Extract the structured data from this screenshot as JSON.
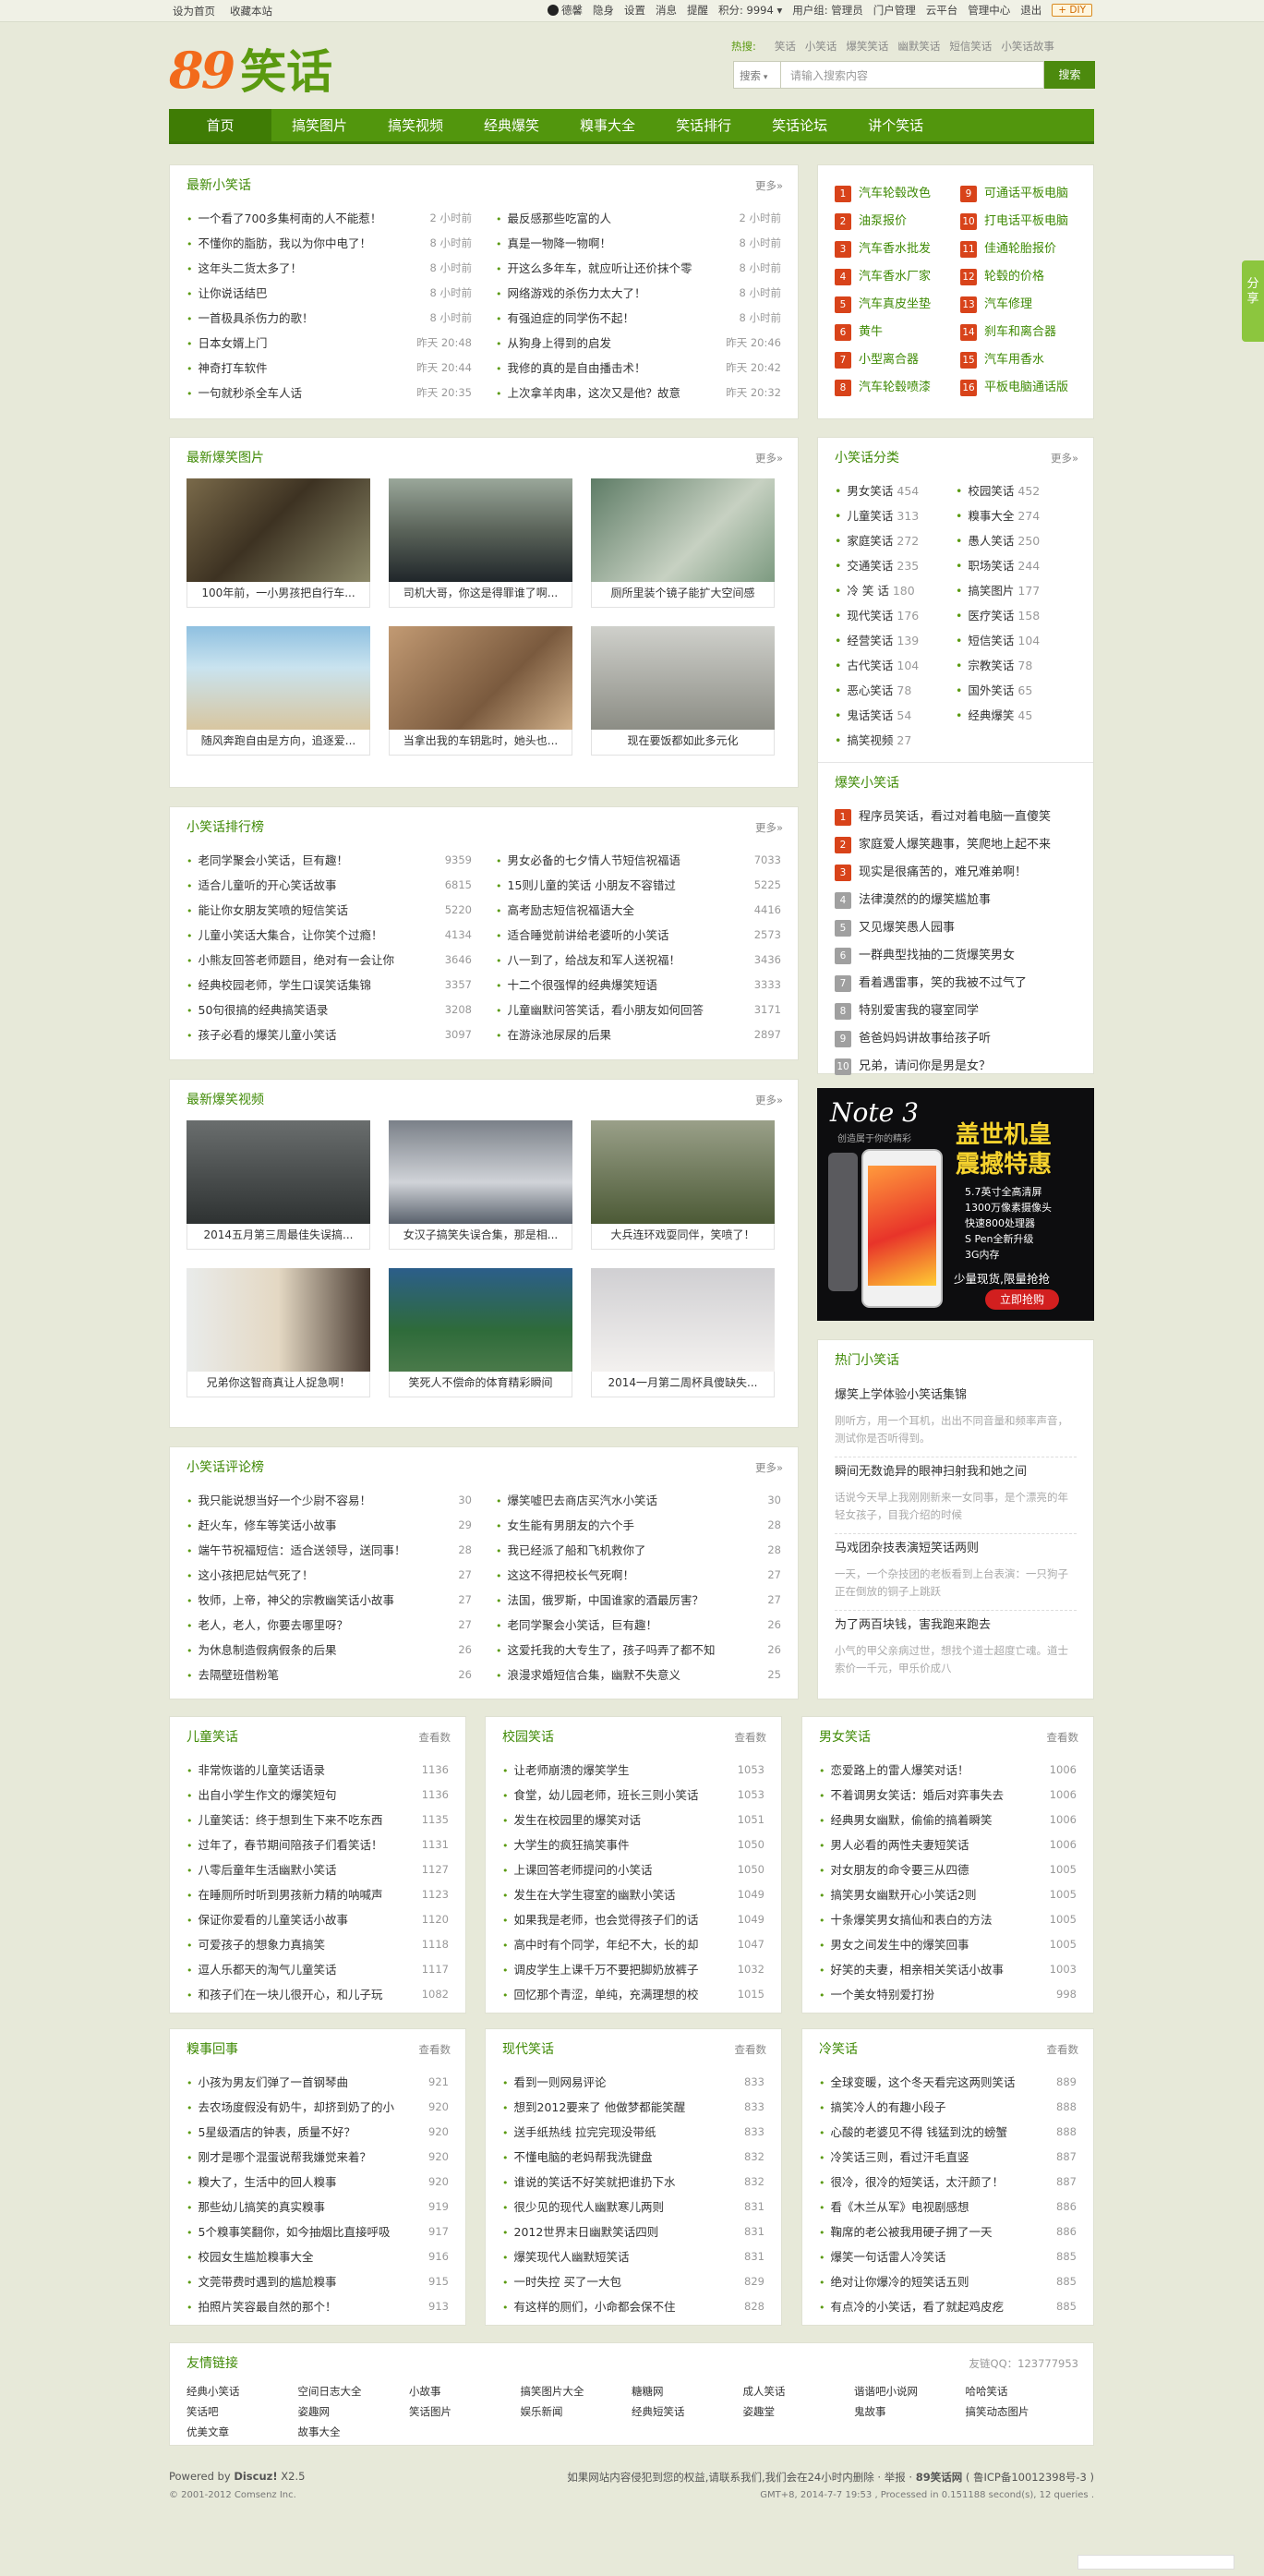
{
  "topbar": {
    "left": [
      "设为首页",
      "收藏本站"
    ],
    "user": "德馨",
    "links": [
      "隐身",
      "设置",
      "消息",
      "提醒"
    ],
    "points": "积分: 9994 ▾",
    "group": "用户组: 管理员",
    "admin": [
      "门户管理",
      "云平台",
      "管理中心",
      "退出"
    ],
    "diy": "+ DIY"
  },
  "logo": {
    "num": "89",
    "text": "笑话"
  },
  "hot": {
    "label": "热搜:",
    "items": [
      "笑话",
      "小笑话",
      "爆笑笑话",
      "幽默笑话",
      "短信笑话",
      "小笑话故事"
    ]
  },
  "search": {
    "type": "搜索",
    "placeholder": "请输入搜索内容",
    "button": "搜索"
  },
  "nav": [
    "首页",
    "搞笑图片",
    "搞笑视频",
    "经典爆笑",
    "糗事大全",
    "笑话排行",
    "笑话论坛",
    "讲个笑话"
  ],
  "latest": {
    "title": "最新小笑话",
    "more": "更多»",
    "left": [
      [
        "一个看了700多集柯南的人不能惹！",
        "2 小时前"
      ],
      [
        "不懂你的脂肪，我以为你中电了！",
        "8 小时前"
      ],
      [
        "这年头二货太多了！",
        "8 小时前"
      ],
      [
        "让你说话结巴",
        "8 小时前"
      ],
      [
        "一首极具杀伤力的歌！",
        "8 小时前"
      ],
      [
        "日本女婿上门",
        "昨天 20:48"
      ],
      [
        "神奇打车软件",
        "昨天 20:44"
      ],
      [
        "一句就秒杀全车人话",
        "昨天 20:35"
      ]
    ],
    "right": [
      [
        "最反感那些吃富的人",
        "2 小时前"
      ],
      [
        "真是一物降一物啊！",
        "8 小时前"
      ],
      [
        "开这么多年车，就应听让还价抹个零",
        "8 小时前"
      ],
      [
        "网络游戏的杀伤力太大了！",
        "8 小时前"
      ],
      [
        "有强迫症的同学伤不起！",
        "8 小时前"
      ],
      [
        "从狗身上得到的启发",
        "昨天 20:46"
      ],
      [
        "我修的真的是自由播击术！",
        "昨天 20:42"
      ],
      [
        "上次拿羊肉串，这次又是他？故意",
        "昨天 20:32"
      ]
    ]
  },
  "toplinks": {
    "left": [
      [
        "1",
        "汽车轮毂改色"
      ],
      [
        "2",
        "油泵报价"
      ],
      [
        "3",
        "汽车香水批发"
      ],
      [
        "4",
        "汽车香水厂家"
      ],
      [
        "5",
        "汽车真皮坐垫"
      ],
      [
        "6",
        "黄牛"
      ],
      [
        "7",
        "小型离合器"
      ],
      [
        "8",
        "汽车轮毂喷漆"
      ]
    ],
    "right": [
      [
        "9",
        "可通话平板电脑"
      ],
      [
        "10",
        "打电话平板电脑"
      ],
      [
        "11",
        "佳通轮胎报价"
      ],
      [
        "12",
        "轮毂的价格"
      ],
      [
        "13",
        "汽车修理"
      ],
      [
        "14",
        "刹车和离合器"
      ],
      [
        "15",
        "汽车用香水"
      ],
      [
        "16",
        "平板电脑通话版"
      ]
    ]
  },
  "pics": {
    "title": "最新爆笑图片",
    "more": "更多»",
    "items": [
      "100年前，一小男孩把自行车...",
      "司机大哥，你这是得罪谁了啊...",
      "厕所里装个镜子能扩大空间感",
      "随风奔跑自由是方向，追逐爱...",
      "当拿出我的车钥匙时，她头也...",
      "现在要饭都如此多元化"
    ]
  },
  "rank": {
    "title": "小笑话排行榜",
    "more": "更多»",
    "left": [
      [
        "老同学聚会小笑话，巨有趣！",
        "9359"
      ],
      [
        "适合儿童听的开心笑话故事",
        "6815"
      ],
      [
        "能让你女朋友笑喷的短信笑话",
        "5220"
      ],
      [
        "儿童小笑话大集合，让你笑个过瘾！",
        "4134"
      ],
      [
        "小熊友回答老师题目，绝对有一会让你",
        "3646"
      ],
      [
        "经典校园老师，学生口误笑话集锦",
        "3357"
      ],
      [
        "50句很搞的经典搞笑语录",
        "3208"
      ],
      [
        "孩子必看的爆笑儿童小笑话",
        "3097"
      ]
    ],
    "right": [
      [
        "男女必备的七夕情人节短信祝福语",
        "7033"
      ],
      [
        "15则儿童的笑话 小朋友不容错过",
        "5225"
      ],
      [
        "高考励志短信祝福语大全",
        "4416"
      ],
      [
        "适合睡觉前讲给老婆听的小笑话",
        "2573"
      ],
      [
        "八一到了，给战友和军人送祝福！",
        "3436"
      ],
      [
        "十二个很强悍的经典爆笑短语",
        "3333"
      ],
      [
        "儿童幽默问答笑话，看小朋友如何回答",
        "3171"
      ],
      [
        "在游泳池尿尿的后果",
        "2897"
      ]
    ]
  },
  "cats": {
    "title": "小笑话分类",
    "more": "更多»",
    "items": [
      [
        "男女笑话",
        "454"
      ],
      [
        "校园笑话",
        "452"
      ],
      [
        "儿童笑话",
        "313"
      ],
      [
        "糗事大全",
        "274"
      ],
      [
        "家庭笑话",
        "272"
      ],
      [
        "愚人笑话",
        "250"
      ],
      [
        "交通笑话",
        "235"
      ],
      [
        "职场笑话",
        "244"
      ],
      [
        "冷 笑 话",
        "180"
      ],
      [
        "搞笑图片",
        "177"
      ],
      [
        "现代笑话",
        "176"
      ],
      [
        "医疗笑话",
        "158"
      ],
      [
        "经营笑话",
        "139"
      ],
      [
        "短信笑话",
        "104"
      ],
      [
        "古代笑话",
        "104"
      ],
      [
        "宗教笑话",
        "78"
      ],
      [
        "恶心笑话",
        "78"
      ],
      [
        "国外笑话",
        "65"
      ],
      [
        "鬼话笑话",
        "54"
      ],
      [
        "经典爆笑",
        "45"
      ],
      [
        "搞笑视频",
        "27"
      ]
    ]
  },
  "hotrank": {
    "title": "爆笑小笑话",
    "items": [
      "程序员笑话，看过对着电脑一直傻笑",
      "家庭爱人爆笑趣事，笑爬地上起不来",
      "现实是很痛苦的，难兄难弟啊！",
      "法律漠然的的爆笑尴尬事",
      "又见爆笑愚人园事",
      "一群典型找抽的二货爆笑男女",
      "看着遇雷事，笑的我被不过气了",
      "特别爱害我的寝室同学",
      "爸爸妈妈讲故事给孩子听",
      "兄弟，请问你是男是女？"
    ]
  },
  "ad": {
    "brand": "Note 3",
    "slogan": "创造属于你的精彩",
    "title1": "盖世机皇",
    "title2": "震撼特惠",
    "specs": [
      "5.7英寸全高清屏",
      "1300万像素摄像头",
      "快速800处理器",
      "S Pen全新升级",
      "3G内存"
    ],
    "promo": "少量现货,限量抢抢",
    "btn": "立即抢购"
  },
  "videos": {
    "title": "最新爆笑视频",
    "more": "更多»",
    "items": [
      "2014五月第三周最佳失误搞...",
      "女汉子搞笑失误合集，那是相...",
      "大兵连环戏耍同伴，笑喷了！",
      "兄弟你这智商真让人捉急啊！",
      "笑死人不偿命的体育精彩瞬间",
      "2014一月第二周杯具傻缺失..."
    ]
  },
  "hotjokes": {
    "title": "热门小笑话",
    "items": [
      [
        "爆笑上学体验小笑话集锦",
        "刚听方，用一个耳机，出出不同音量和频率声音，测试你是否听得到。"
      ],
      [
        "瞬间无数诡异的眼神扫射我和她之间",
        "话说今天早上我刚刚新来一女同事，是个漂亮的年轻女孩子，目我介绍的时候"
      ],
      [
        "马戏团杂技表演短笑话两则",
        "一天，一个杂技团的老板看到上台表演：一只狗子正在倒放的铜子上跳跃"
      ],
      [
        "为了两百块钱，害我跑来跑去",
        "小气的甲父亲病过世，想找个道士超度亡魂。道士索价一千元，甲乐价成八"
      ]
    ]
  },
  "comment": {
    "title": "小笑话评论榜",
    "more": "更多»",
    "left": [
      [
        "我只能说想当好一个少尉不容易！",
        "30"
      ],
      [
        "赶火车，修车等笑话小故事",
        "29"
      ],
      [
        "端午节祝福短信：适合送领导，送同事！",
        "28"
      ],
      [
        "这小孩把尼姑气死了！",
        "27"
      ],
      [
        "牧师，上帝，神父的宗教幽笑话小故事",
        "27"
      ],
      [
        "老人，老人，你要去哪里呀？",
        "27"
      ],
      [
        "为休息制造假病假条的后果",
        "26"
      ],
      [
        "去隔壁班借粉笔",
        "26"
      ]
    ],
    "right": [
      [
        "爆笑嘘巴去商店买汽水小笑话",
        "30"
      ],
      [
        "女生能有男朋友的六个手",
        "28"
      ],
      [
        "我已经派了船和飞机救你了",
        "28"
      ],
      [
        "这这不得把校长气死啊！",
        "27"
      ],
      [
        "法国，俄罗斯，中国谁家的酒最厉害？",
        "27"
      ],
      [
        "老同学聚会小笑话，巨有趣！",
        "26"
      ],
      [
        "这爱托我的大专生了，孩子吗弄了都不知",
        "26"
      ],
      [
        "浪漫求婚短信合集，幽默不失意义",
        "25"
      ]
    ]
  },
  "cols3": [
    {
      "title": "儿童笑话",
      "more": "查看数",
      "items": [
        [
          "非常恢谐的儿童笑话语录",
          "1136"
        ],
        [
          "出自小学生作文的爆笑短句",
          "1136"
        ],
        [
          "儿童笑话：终于想到生下来不吃东西",
          "1135"
        ],
        [
          "过年了，春节期间陪孩子们看笑话！",
          "1131"
        ],
        [
          "八零后童年生活幽默小笑话",
          "1127"
        ],
        [
          "在睡厕所时听到男孩新力精的呐喊声",
          "1123"
        ],
        [
          "保证你爱看的儿童笑话小故事",
          "1120"
        ],
        [
          "可爱孩子的想象力真搞笑",
          "1118"
        ],
        [
          "逗人乐都天的淘气儿童笑话",
          "1117"
        ],
        [
          "和孩子们在一块儿很开心，和儿子玩",
          "1082"
        ]
      ]
    },
    {
      "title": "校园笑话",
      "more": "查看数",
      "items": [
        [
          "让老师崩溃的爆笑学生",
          "1053"
        ],
        [
          "食堂，幼儿园老师，班长三则小笑话",
          "1053"
        ],
        [
          "发生在校园里的爆笑对话",
          "1051"
        ],
        [
          "大学生的疯狂搞笑事件",
          "1050"
        ],
        [
          "上课回答老师提问的小笑话",
          "1050"
        ],
        [
          "发生在大学生寝室的幽默小笑话",
          "1049"
        ],
        [
          "如果我是老师，也会觉得孩子们的话",
          "1049"
        ],
        [
          "高中时有个同学，年纪不大，长的却",
          "1047"
        ],
        [
          "调皮学生上课千万不要把脚奶放裤子",
          "1032"
        ],
        [
          "回忆那个青涩，单纯，充满理想的校",
          "1015"
        ]
      ]
    },
    {
      "title": "男女笑话",
      "more": "查看数",
      "items": [
        [
          "恋爱路上的雷人爆笑对话！",
          "1006"
        ],
        [
          "不着调男女笑话：婚后对弈事失去",
          "1006"
        ],
        [
          "经典男女幽默，偷偷的搞着瞬笑",
          "1006"
        ],
        [
          "男人必看的两性夫妻短笑话",
          "1006"
        ],
        [
          "对女朋友的命令要三从四德",
          "1005"
        ],
        [
          "搞笑男女幽默开心小笑话2则",
          "1005"
        ],
        [
          "十条爆笑男女搞仙和表白的方法",
          "1005"
        ],
        [
          "男女之间发生中的爆笑回事",
          "1005"
        ],
        [
          "好笑的夫妻，相亲相关笑话小故事",
          "1003"
        ],
        [
          "一个美女特别爱打扮",
          "998"
        ]
      ]
    },
    {
      "title": "糗事回事",
      "more": "查看数",
      "items": [
        [
          "小孩为男友们弹了一首钢琴曲",
          "921"
        ],
        [
          "去农场度假没有奶牛，却挤到奶了的小",
          "920"
        ],
        [
          "5星级酒店的钟表，质量不好？",
          "920"
        ],
        [
          "刚才是哪个混蛋说帮我嫌觉来着？",
          "920"
        ],
        [
          "糗大了，生活中的回人糗事",
          "920"
        ],
        [
          "那些幼儿搞笑的真实糗事",
          "919"
        ],
        [
          "5个糗事笑翻你，如今抽烟比直接呼吸",
          "917"
        ],
        [
          "校园女生尴尬糗事大全",
          "916"
        ],
        [
          "文莞带费时遇到的尴尬糗事",
          "915"
        ],
        [
          "拍照片笑容最自然的那个！",
          "913"
        ]
      ]
    },
    {
      "title": "现代笑话",
      "more": "查看数",
      "items": [
        [
          "看到一则网易评论",
          "833"
        ],
        [
          "想到2012要来了 他做梦都能笑醒",
          "833"
        ],
        [
          "送手纸热线 拉完完现没带纸",
          "833"
        ],
        [
          "不懂电脑的老妈帮我洗键盘",
          "832"
        ],
        [
          "谁说的笑话不好笑就把谁扔下水",
          "832"
        ],
        [
          "很少见的现代人幽默寒儿两则",
          "831"
        ],
        [
          "2012世界末日幽默笑话四则",
          "831"
        ],
        [
          "爆笑现代人幽默短笑话",
          "831"
        ],
        [
          "一时失控 买了一大包",
          "829"
        ],
        [
          "有这样的厕们，小命都会保不住",
          "828"
        ]
      ]
    },
    {
      "title": "冷笑话",
      "more": "查看数",
      "items": [
        [
          "全球变暖，这个冬天看完这两则笑话",
          "889"
        ],
        [
          "搞笑冷人的有趣小段子",
          "888"
        ],
        [
          "心酸的老婆见不得 钱猛到沈的螃蟹",
          "888"
        ],
        [
          "冷笑话三则，看过汗毛直竖",
          "887"
        ],
        [
          "很冷，很冷的短笑话，太汗颜了！",
          "887"
        ],
        [
          "看《木兰从军》电视剧感想",
          "886"
        ],
        [
          "鞠席的老公被我用硬子拥了一天",
          "886"
        ],
        [
          "爆笑一句话雷人冷笑话",
          "885"
        ],
        [
          "绝对让你爆冷的短笑话五则",
          "885"
        ],
        [
          "有点冷的小笑话，看了就起鸡皮疙",
          "885"
        ]
      ]
    }
  ],
  "friend": {
    "title": "友情链接",
    "qq": "友链QQ：123777953",
    "items": [
      "经典小笑话",
      "空间日志大全",
      "小故事",
      "搞笑图片大全",
      "糖糖网",
      "成人笑话",
      "谐谐吧小说网",
      "哈哈笑话",
      "笑话吧",
      "姿趣网",
      "笑话图片",
      "娱乐新闻",
      "经典短笑话",
      "姿趣堂",
      "鬼故事",
      "搞笑动态图片",
      "优美文章",
      "故事大全"
    ]
  },
  "footer": {
    "powered": "Powered by",
    "disc": "Discuz!",
    "ver": "X2.5",
    "copy": "© 2001-2012 Comsenz Inc.",
    "notice": "如果网站内容侵犯到您的权益,请联系我们,我们会在24小时内删除",
    "report": "举报",
    "site": "89笑话网",
    "icp": "( 鲁ICP备10012398号-3 )",
    "gmt": "GMT+8, 2014-7-7 19:53 , Processed in 0.151188 second(s), 12 queries ."
  },
  "share": "分享"
}
